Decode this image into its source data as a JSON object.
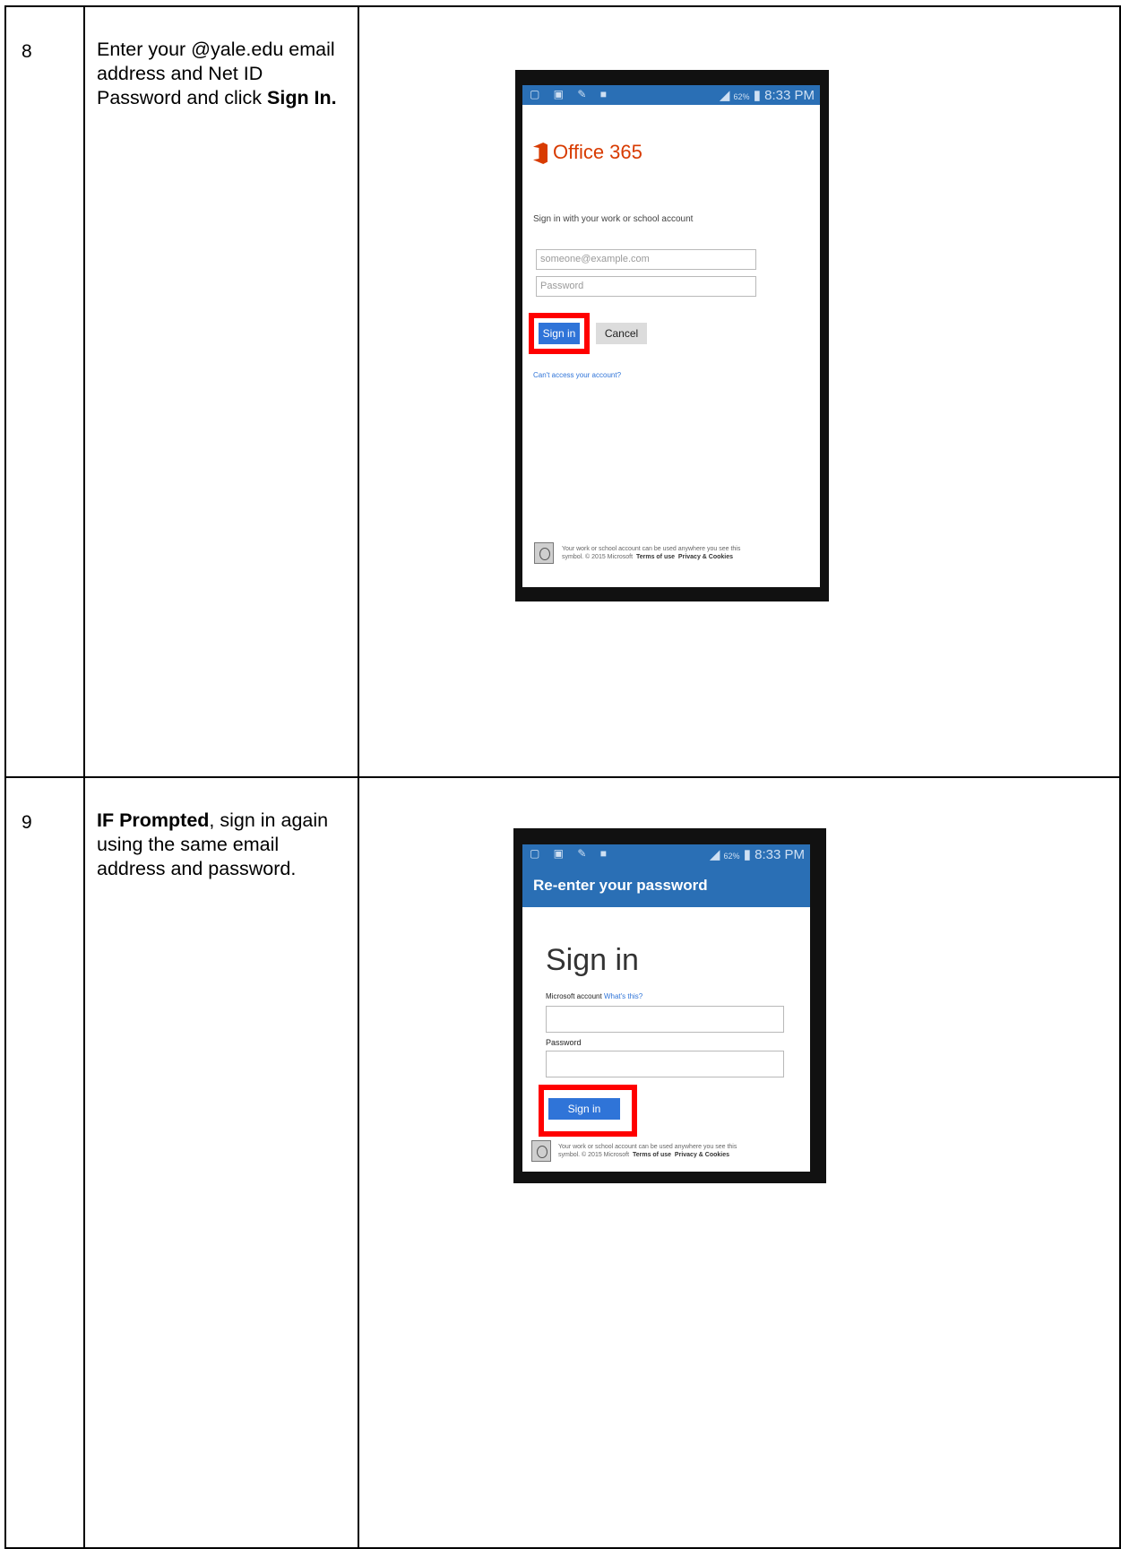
{
  "steps": [
    {
      "number": "8",
      "text_runs": [
        {
          "text": "Enter your @yale.edu email address and Net ID Password and click ",
          "bold": false
        },
        {
          "text": "Sign In.",
          "bold": true
        }
      ],
      "screenshot": {
        "status_time": "8:33 PM",
        "battery": "62%",
        "logo_text": "Office 365",
        "logo_color": "#d83b01",
        "prompt": "Sign in with your work or school account",
        "email_placeholder": "someone@example.com",
        "password_placeholder": "Password",
        "signin_label": "Sign in",
        "cancel_label": "Cancel",
        "cant_access": "Can't access your account?",
        "footer_line1": "Your work or school account can be used anywhere you see this",
        "footer_line2_prefix": "symbol. © 2015 Microsoft",
        "terms": "Terms of use",
        "privacy": "Privacy & Cookies"
      }
    },
    {
      "number": "9",
      "text_runs": [
        {
          "text": "IF Prompted",
          "bold": true
        },
        {
          "text": ", sign in again using the same email address and password.",
          "bold": false
        }
      ],
      "screenshot": {
        "status_time": "8:33 PM",
        "battery": "62%",
        "header": "Re-enter your password",
        "heading": "Sign in",
        "account_label": "Microsoft account",
        "whats_this": "What's this?",
        "password_label": "Password",
        "signin_label": "Sign in",
        "footer_line1": "Your work or school account can be used anywhere you see this",
        "footer_line2_prefix": "symbol. © 2015 Microsoft",
        "terms": "Terms of use",
        "privacy": "Privacy & Cookies"
      }
    }
  ],
  "colors": {
    "status_bar": "#2a6fb5",
    "highlight": "#ff0000",
    "button": "#2f74d8",
    "link": "#2f74d8"
  }
}
